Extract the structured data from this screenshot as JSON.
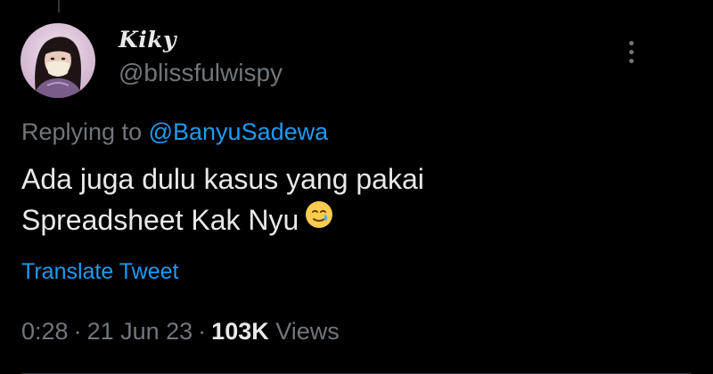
{
  "user": {
    "display_name": "Kiky",
    "handle": "@blissfulwispy"
  },
  "reply": {
    "prefix": "Replying to",
    "mention": "@BanyuSadewa"
  },
  "tweet": {
    "lines": [
      "Ada juga dulu kasus yang pakai",
      "Spreadsheet Kak Nyu"
    ],
    "emoji": "smiling-face-with-tear"
  },
  "translate_label": "Translate Tweet",
  "meta": {
    "time": "0:28",
    "dot": "·",
    "date": "21 Jun 23",
    "views_count": "103K",
    "views_label": "Views"
  },
  "icons": {
    "more": "more-vertical-icon",
    "avatar": "profile-avatar"
  },
  "colors": {
    "background": "#000000",
    "text_primary": "#e7e9ea",
    "text_secondary": "#71767b",
    "accent": "#1d9bf0"
  }
}
